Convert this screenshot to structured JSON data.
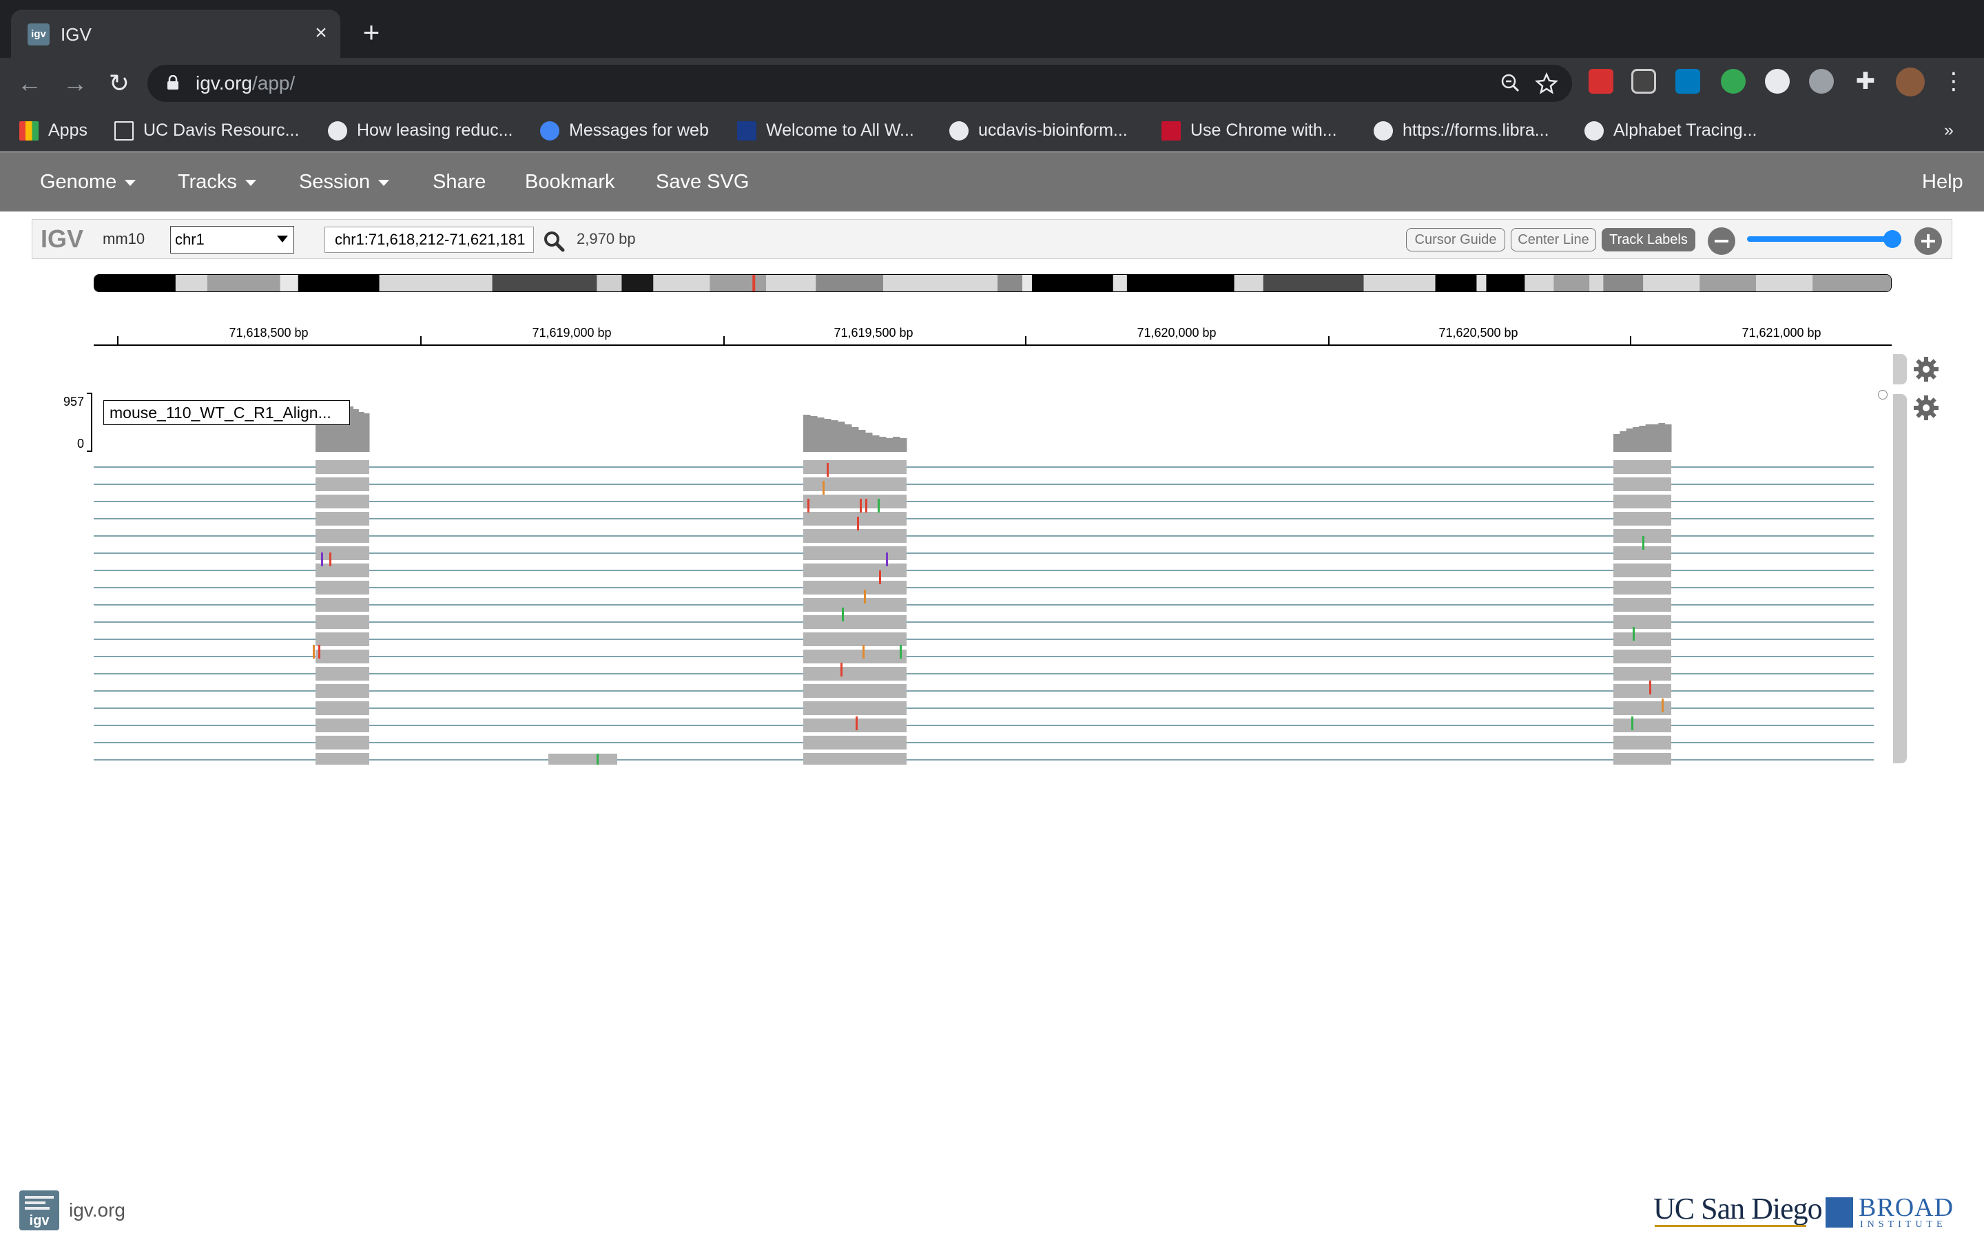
{
  "browser": {
    "tab": {
      "title": "IGV",
      "close": "×",
      "new_tab": "+"
    },
    "nav": {
      "back": "←",
      "forward": "→",
      "reload": "↻"
    },
    "url": {
      "host": "igv.org",
      "path": "/app/"
    },
    "bookmarks": [
      {
        "label": "Apps",
        "icon": "apps-grid-icon"
      },
      {
        "label": "UC Davis Resourc...",
        "icon": "folder-icon"
      },
      {
        "label": "How leasing reduc...",
        "icon": "globe-icon"
      },
      {
        "label": "Messages for web",
        "icon": "messages-icon"
      },
      {
        "label": "Welcome to All W...",
        "icon": "person-icon"
      },
      {
        "label": "ucdavis-bioinform...",
        "icon": "globe-icon"
      },
      {
        "label": "Use Chrome with...",
        "icon": "shield-icon"
      },
      {
        "label": "https://forms.libra...",
        "icon": "globe-icon"
      },
      {
        "label": "Alphabet Tracing...",
        "icon": "wordpress-icon"
      }
    ],
    "bookmarks_overflow": "»"
  },
  "igv": {
    "menu": {
      "genome": "Genome",
      "tracks": "Tracks",
      "session": "Session",
      "share": "Share",
      "bookmark": "Bookmark",
      "save_svg": "Save SVG",
      "help": "Help"
    },
    "controls": {
      "logo": "IGV",
      "genome_id": "mm10",
      "chromosome": "chr1",
      "locus": "chr1:71,618,212-71,621,181",
      "window_size": "2,970 bp",
      "cursor_guide": "Cursor Guide",
      "center_line": "Center Line",
      "track_labels": "Track Labels",
      "zoom_level": 0.98
    },
    "ruler": {
      "ticks": [
        "71,618,500 bp",
        "71,619,000 bp",
        "71,619,500 bp",
        "71,620,000 bp",
        "71,620,500 bp",
        "71,621,000 bp"
      ]
    },
    "track": {
      "name": "mouse_110_WT_C_R1_Align...",
      "coverage_max": "957",
      "coverage_min": "0"
    }
  },
  "footer": {
    "site": "igv.org",
    "ucsd": "UC San Diego",
    "broad": "BROAD",
    "broad_sub": "INSTITUTE"
  },
  "colors": {
    "igv_navbar": "#737373",
    "read_gray": "#b4b4b4",
    "coverage_gray": "#969696",
    "mismatch_red": "#e0402f",
    "mismatch_green": "#2fb24a",
    "mismatch_orange": "#e08a2f",
    "insertion_purple": "#7a35c8",
    "zoom_blue": "#1a8cff"
  }
}
